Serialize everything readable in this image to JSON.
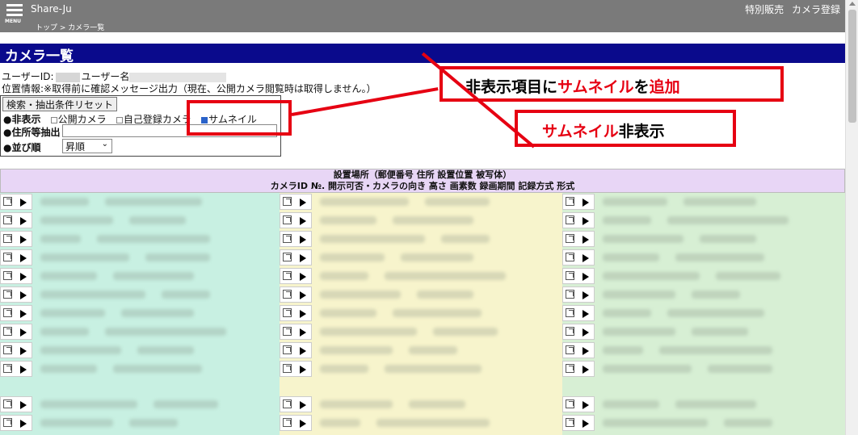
{
  "header": {
    "menu_label": "MENU",
    "brand": "Share-Ju",
    "breadcrumb": "トップ > カメラ一覧",
    "links": [
      "特別販売",
      "カメラ登録"
    ]
  },
  "page": {
    "title": "カメラ一覧",
    "user_id_label": "ユーザーID:",
    "user_name_label": "ユーザー名",
    "location_info": "位置情報:※取得前に確認メッセージ出力（現在、公開カメラ閲覧時は取得しません。）"
  },
  "filter": {
    "reset_button": "検索・抽出条件リセット",
    "hide_label": "●非表示",
    "options": [
      {
        "label": "公開カメラ",
        "checked": false
      },
      {
        "label": "自己登録カメラ",
        "checked": false
      },
      {
        "label": "サムネイル",
        "checked": true
      }
    ],
    "address_label": "●住所等抽出",
    "address_value": "",
    "sort_label": "●並び順",
    "sort_value": "昇順"
  },
  "callouts": {
    "top": {
      "prefix": "非表示項目に",
      "red1": "サムネイル",
      "mid": "を",
      "red2": "追加"
    },
    "second": {
      "red": "サムネイル",
      "suffix": "非表示"
    }
  },
  "table": {
    "header_line1": "設置場所（郵便番号 住所 設置位置 被写体）",
    "header_line2": "カメラID №. 開示可否・カメラの向き 高さ 画素数 録画期間 記録方式 形式"
  },
  "colors": {
    "topbar": "#7a7a7a",
    "title_bar": "#0a0a8c",
    "callout_red": "#e60012",
    "col1": "#c8f0e2",
    "col2": "#f7f4cc",
    "col3": "#d7efd4",
    "table_header": "#e8d6f6"
  }
}
